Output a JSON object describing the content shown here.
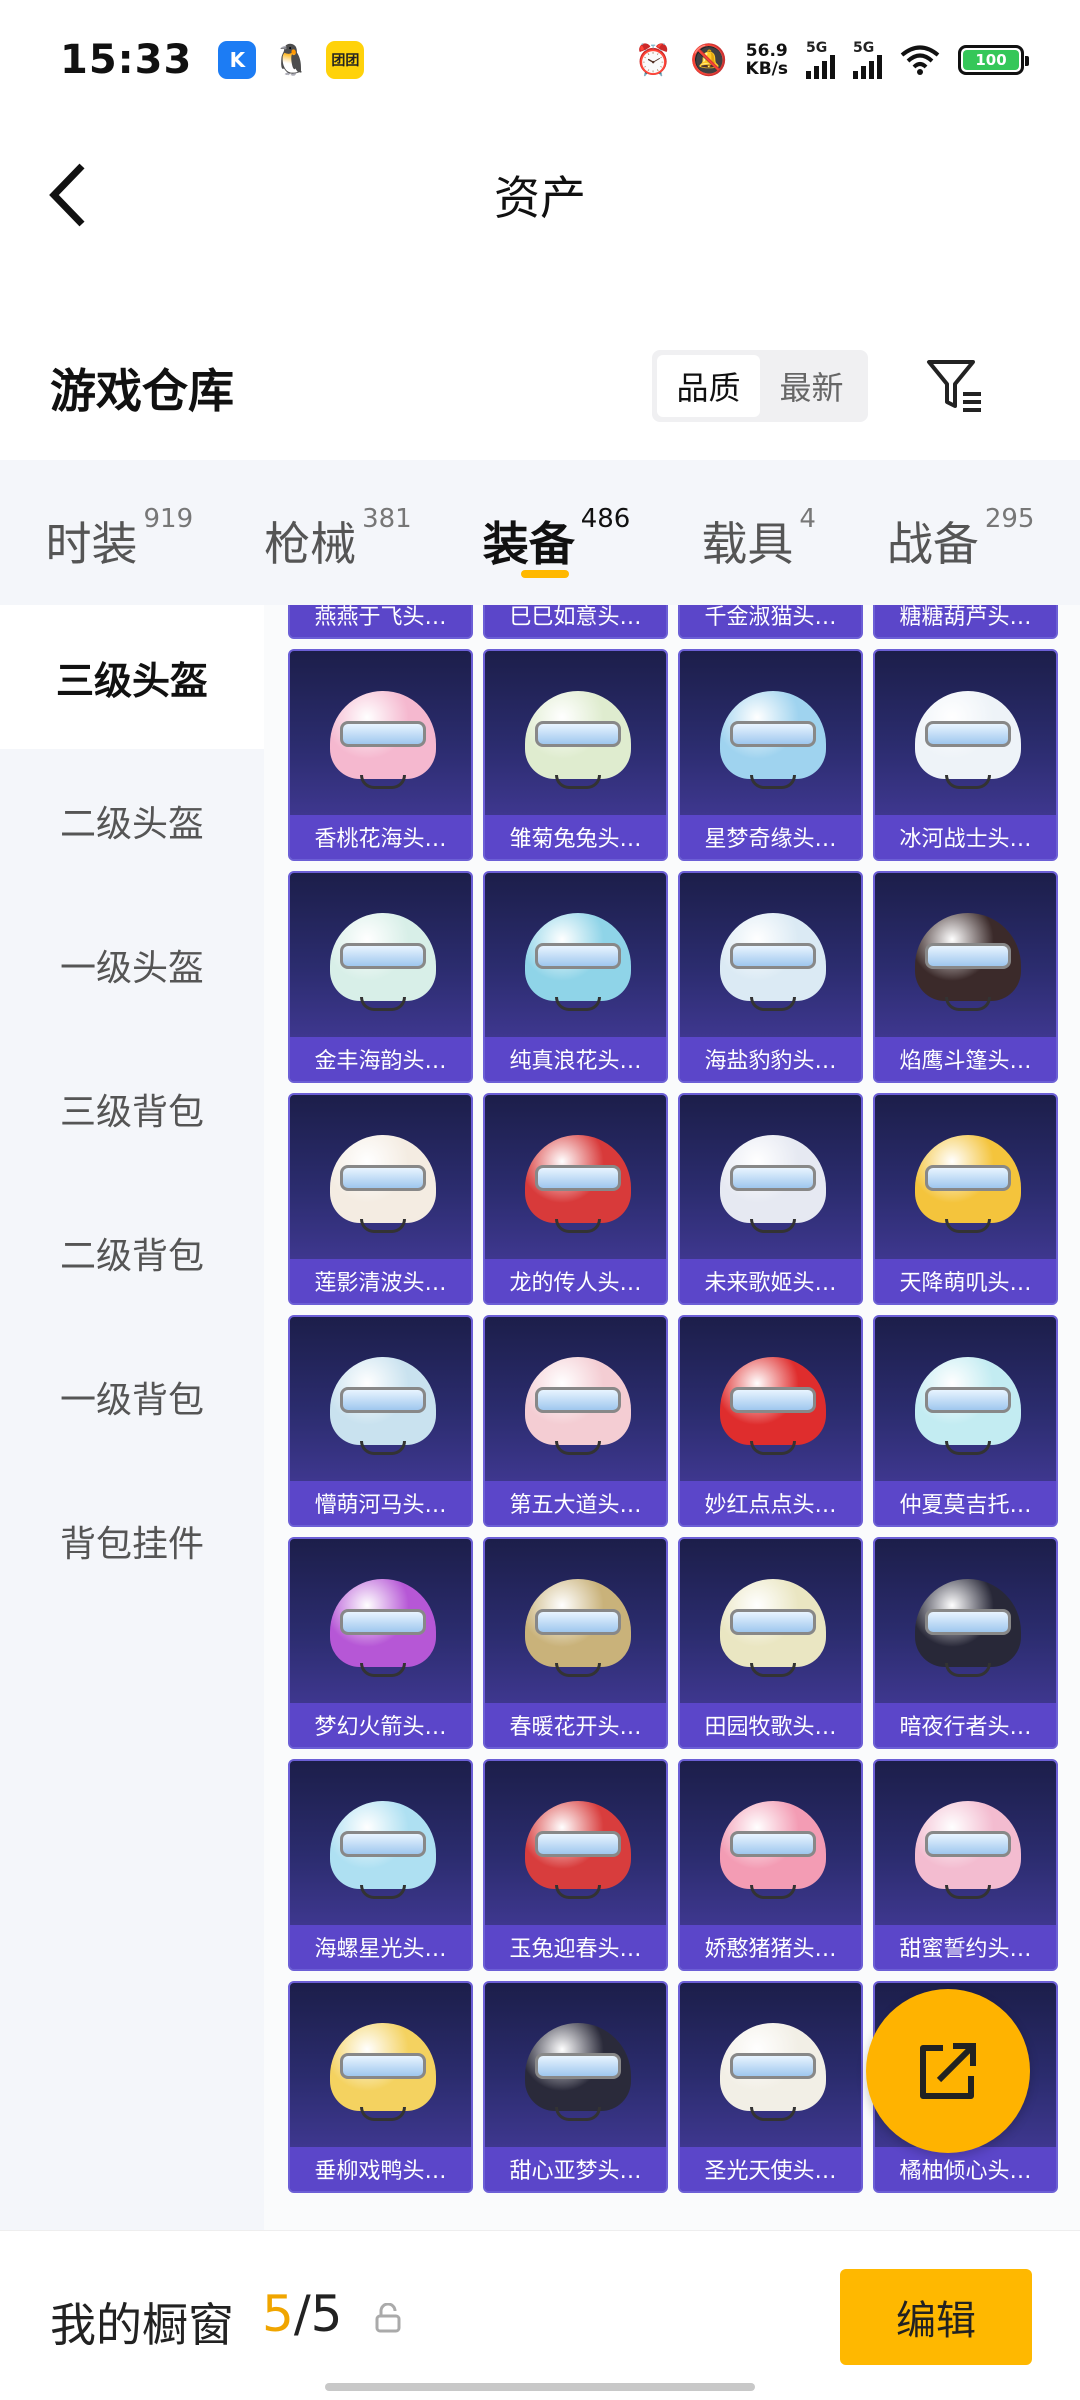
{
  "status_bar": {
    "time": "15:33",
    "apps": [
      "K",
      "🐧",
      "团团"
    ],
    "net_speed_value": "56.9",
    "net_speed_unit": "KB/s",
    "signal1_label": "5G",
    "signal2_label": "5G",
    "battery": "100"
  },
  "header": {
    "title": "资产",
    "back_icon": "chevron-left-icon"
  },
  "warehouse": {
    "title": "游戏仓库",
    "sort_options": [
      "品质",
      "最新"
    ],
    "selected_sort": "品质",
    "filter_icon": "filter-icon"
  },
  "tabs": [
    {
      "label": "时装",
      "count": "919"
    },
    {
      "label": "枪械",
      "count": "381"
    },
    {
      "label": "装备",
      "count": "486"
    },
    {
      "label": "载具",
      "count": "4"
    },
    {
      "label": "战备",
      "count": "295"
    }
  ],
  "active_tab": "装备",
  "sidebar": {
    "items": [
      "三级头盔",
      "二级头盔",
      "一级头盔",
      "三级背包",
      "二级背包",
      "一级背包",
      "背包挂件"
    ],
    "active": "三级头盔"
  },
  "items": [
    {
      "name": "燕燕于飞头…",
      "color": "#d9b3e0"
    },
    {
      "name": "巳巳如意头…",
      "color": "#e8c8a8"
    },
    {
      "name": "千金淑猫头…",
      "color": "#f0d0d8"
    },
    {
      "name": "糖糖葫芦头…",
      "color": "#e07a7a"
    },
    {
      "name": "香桃花海头…",
      "color": "#f5b8cf"
    },
    {
      "name": "雏菊兔兔头…",
      "color": "#dfeccf"
    },
    {
      "name": "星梦奇缘头…",
      "color": "#9fd3ef"
    },
    {
      "name": "冰河战士头…",
      "color": "#eef3f8"
    },
    {
      "name": "金丰海韵头…",
      "color": "#d8efe8"
    },
    {
      "name": "纯真浪花头…",
      "color": "#8fd4e8"
    },
    {
      "name": "海盐豹豹头…",
      "color": "#dbeaf4"
    },
    {
      "name": "焰鹰斗篷头…",
      "color": "#3b2a2a"
    },
    {
      "name": "莲影清波头…",
      "color": "#f4ece2"
    },
    {
      "name": "龙的传人头…",
      "color": "#d83a3a"
    },
    {
      "name": "未来歌姬头…",
      "color": "#e6e9f2"
    },
    {
      "name": "天降萌叽头…",
      "color": "#f4c43c"
    },
    {
      "name": "懵萌河马头…",
      "color": "#c9e2ef"
    },
    {
      "name": "第五大道头…",
      "color": "#f4cdd3"
    },
    {
      "name": "妙红点点头…",
      "color": "#df2d2d"
    },
    {
      "name": "仲夏莫吉托…",
      "color": "#c3ecf2"
    },
    {
      "name": "梦幻火箭头…",
      "color": "#b657d6"
    },
    {
      "name": "春暖花开头…",
      "color": "#c9b27a"
    },
    {
      "name": "田园牧歌头…",
      "color": "#eae6c2"
    },
    {
      "name": "暗夜行者头…",
      "color": "#282838"
    },
    {
      "name": "海螺星光头…",
      "color": "#aee0f2"
    },
    {
      "name": "玉兔迎春头…",
      "color": "#d83d3d"
    },
    {
      "name": "娇憨猪猪头…",
      "color": "#f39cb4"
    },
    {
      "name": "甜蜜誓约头…",
      "color": "#f3bcd0"
    },
    {
      "name": "垂柳戏鸭头…",
      "color": "#f4d260"
    },
    {
      "name": "甜心亚梦头…",
      "color": "#2a2a3a"
    },
    {
      "name": "圣光天使头…",
      "color": "#f2efe6"
    },
    {
      "name": "橘柚倾心头…",
      "color": "#f6b85a"
    }
  ],
  "share_icon": "share-icon",
  "bottom": {
    "showcase_label": "我的橱窗",
    "showcase_current": "5",
    "showcase_sep": "/",
    "showcase_total": "5",
    "lock_icon": "lock-icon",
    "edit_label": "编辑"
  },
  "colors": {
    "accent": "#ffb800",
    "card_label": "#5b46c9",
    "showcase_current": "#f0a500"
  }
}
